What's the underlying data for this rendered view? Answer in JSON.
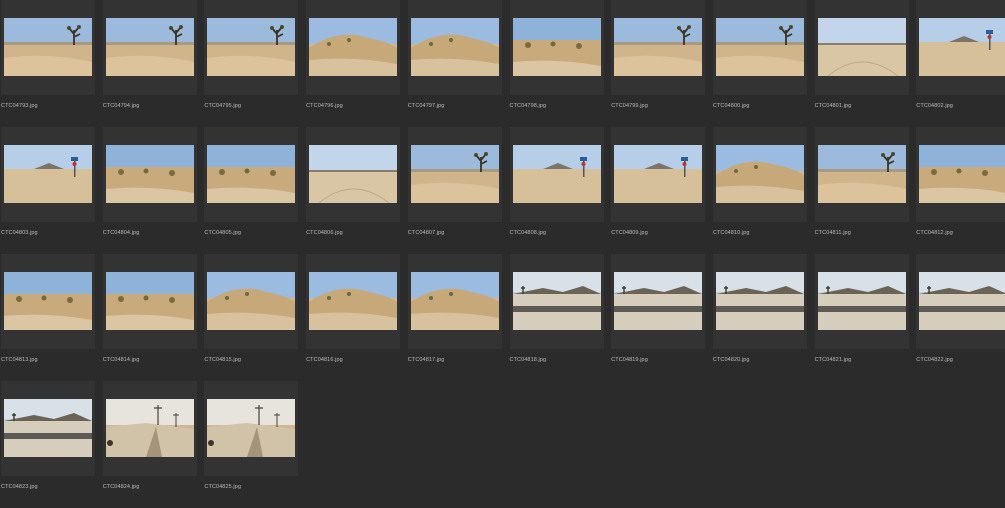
{
  "browser": {
    "files": [
      {
        "name": "CTC04793.jpg",
        "scene": "joshua"
      },
      {
        "name": "CTC04794.jpg",
        "scene": "joshua"
      },
      {
        "name": "CTC04795.jpg",
        "scene": "joshua"
      },
      {
        "name": "CTC04796.jpg",
        "scene": "hill"
      },
      {
        "name": "CTC04797.jpg",
        "scene": "hill"
      },
      {
        "name": "CTC04798.jpg",
        "scene": "scrub"
      },
      {
        "name": "CTC04799.jpg",
        "scene": "joshua"
      },
      {
        "name": "CTC04800.jpg",
        "scene": "joshua"
      },
      {
        "name": "CTC04801.jpg",
        "scene": "flat"
      },
      {
        "name": "CTC04802.jpg",
        "scene": "sign"
      },
      {
        "name": "CTC04803.jpg",
        "scene": "sign"
      },
      {
        "name": "CTC04804.jpg",
        "scene": "scrub"
      },
      {
        "name": "CTC04805.jpg",
        "scene": "scrub"
      },
      {
        "name": "CTC04806.jpg",
        "scene": "flat"
      },
      {
        "name": "CTC04807.jpg",
        "scene": "joshua"
      },
      {
        "name": "CTC04808.jpg",
        "scene": "sign"
      },
      {
        "name": "CTC04809.jpg",
        "scene": "sign"
      },
      {
        "name": "CTC04810.jpg",
        "scene": "hill"
      },
      {
        "name": "CTC04811.jpg",
        "scene": "joshua"
      },
      {
        "name": "CTC04812.jpg",
        "scene": "scrub"
      },
      {
        "name": "CTC04813.jpg",
        "scene": "scrub"
      },
      {
        "name": "CTC04814.jpg",
        "scene": "scrub"
      },
      {
        "name": "CTC04815.jpg",
        "scene": "hill"
      },
      {
        "name": "CTC04816.jpg",
        "scene": "hill"
      },
      {
        "name": "CTC04817.jpg",
        "scene": "hill"
      },
      {
        "name": "CTC04818.jpg",
        "scene": "road"
      },
      {
        "name": "CTC04819.jpg",
        "scene": "road"
      },
      {
        "name": "CTC04820.jpg",
        "scene": "road"
      },
      {
        "name": "CTC04821.jpg",
        "scene": "road"
      },
      {
        "name": "CTC04822.jpg",
        "scene": "road"
      },
      {
        "name": "CTC04823.jpg",
        "scene": "road"
      },
      {
        "name": "CTC04824.jpg",
        "scene": "poles"
      },
      {
        "name": "CTC04825.jpg",
        "scene": "poles"
      }
    ],
    "colors": {
      "background": "#2b2b2b",
      "tile": "#333333",
      "label": "#bdbdbd"
    }
  }
}
